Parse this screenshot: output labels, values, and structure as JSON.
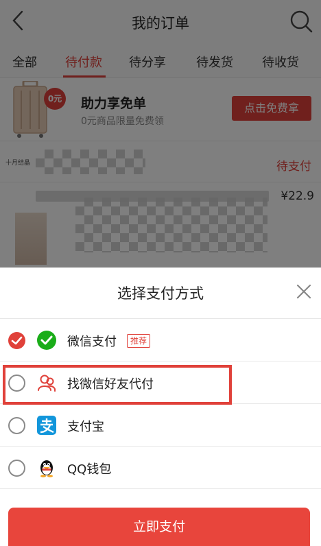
{
  "header": {
    "title": "我的订单"
  },
  "tabs": [
    {
      "label": "全部"
    },
    {
      "label": "待付款"
    },
    {
      "label": "待分享"
    },
    {
      "label": "待发货"
    },
    {
      "label": "待收货"
    }
  ],
  "promo": {
    "badge": "0元",
    "title": "助力享免单",
    "subtitle": "0元商品限量免费领",
    "button": "点击免费拿"
  },
  "orders": [
    {
      "shop": "十月结晶",
      "status": "待支付",
      "price": "¥22.9"
    }
  ],
  "payment_sheet": {
    "title": "选择支付方式",
    "options": [
      {
        "label": "微信支付",
        "badge": "推荐",
        "selected": true,
        "icon": "wechat-pay-icon"
      },
      {
        "label": "找微信好友代付",
        "selected": false,
        "icon": "friend-pay-icon"
      },
      {
        "label": "支付宝",
        "selected": false,
        "icon": "alipay-icon"
      },
      {
        "label": "QQ钱包",
        "selected": false,
        "icon": "qq-wallet-icon"
      }
    ],
    "submit": "立即支付"
  },
  "colors": {
    "accent": "#e0413a",
    "wechat_green": "#1aad19",
    "alipay_blue": "#1296db"
  }
}
